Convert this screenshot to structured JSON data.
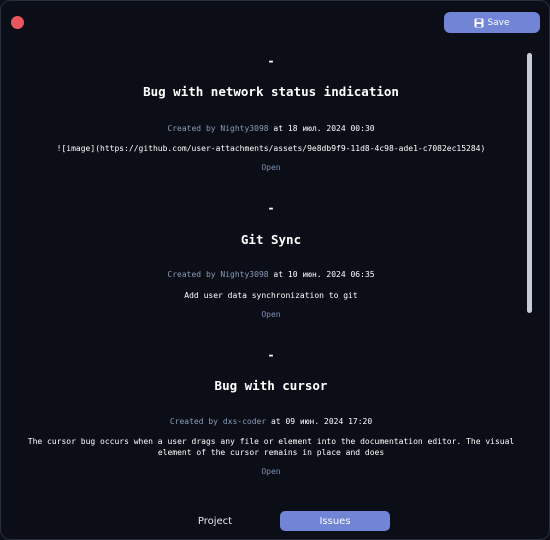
{
  "window": {
    "accent_color": "#7184d6",
    "close_color": "#e8575f"
  },
  "toolbar": {
    "save_label": "Save",
    "save_icon": "save-icon"
  },
  "issues": [
    {
      "separator": "-",
      "title": "Bug with network status indication",
      "created_by_label": "Created by",
      "author": "Nighty3098",
      "at_label": "at",
      "date": "18 июл. 2024 00:30",
      "body": "![image](https://github.com/user-attachments/assets/9e8db9f9-11d8-4c98-ade1-c7082ec15284)",
      "open_label": "Open"
    },
    {
      "separator": "-",
      "title": "Git Sync",
      "created_by_label": "Created by",
      "author": "Nighty3098",
      "at_label": "at",
      "date": "10 июн. 2024 06:35",
      "body": "Add user data synchronization to git",
      "open_label": "Open"
    },
    {
      "separator": "-",
      "title": "Bug with cursor",
      "created_by_label": "Created by",
      "author": "dxs-coder",
      "at_label": "at",
      "date": "09 июн. 2024 17:20",
      "body": "The cursor bug occurs when a user drags any file or element into the documentation editor. The visual element of the cursor remains in place and does",
      "open_label": "Open"
    }
  ],
  "tabs": [
    {
      "label": "Project",
      "active": false
    },
    {
      "label": "Issues",
      "active": true
    }
  ]
}
